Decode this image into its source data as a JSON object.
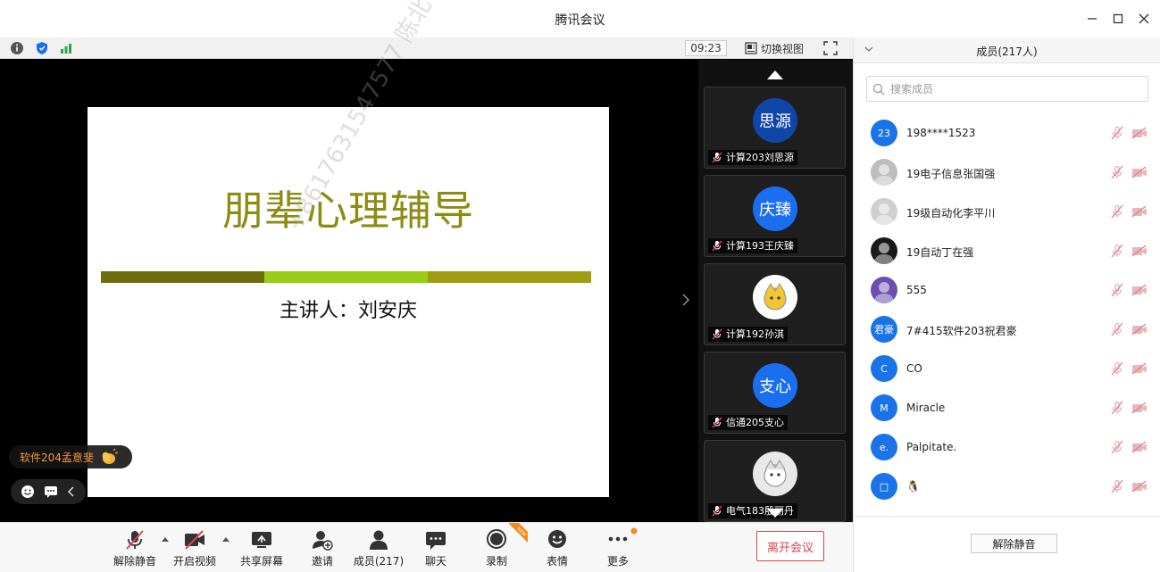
{
  "window": {
    "title": "腾讯会议"
  },
  "infobar": {
    "time": "09:23",
    "switch_view_label": "切换视图"
  },
  "slide": {
    "title": "朋辈心理辅导",
    "subtitle": "主讲人：刘安庆",
    "watermark": "+8617631547577 陈北",
    "bar_colors": [
      "#6e6e0e",
      "#99cc12",
      "#a09e0e"
    ]
  },
  "speaker": {
    "name": "软件204孟意斐"
  },
  "thumbnails": [
    {
      "avatar_text": "思源",
      "name": "计算203刘思源",
      "avatar_color": "#1046a8"
    },
    {
      "avatar_text": "庆臻",
      "name": "计算193王庆臻",
      "avatar_color": "#1a6ef0"
    },
    {
      "avatar_text": "",
      "name": "计算192孙淇",
      "avatar_color": "#ffffff"
    },
    {
      "avatar_text": "支心",
      "name": "信通205支心",
      "avatar_color": "#1a6ef0"
    },
    {
      "avatar_text": "",
      "name": "电气183殷丽丹",
      "avatar_color": "#e8e8e8"
    }
  ],
  "toolbar": {
    "unmute": "解除静音",
    "video": "开启视频",
    "share": "共享屏幕",
    "invite": "邀请",
    "members": "成员(217)",
    "chat": "聊天",
    "record": "录制",
    "emoji": "表情",
    "more": "更多",
    "leave": "离开会议",
    "new_badge": "NEW"
  },
  "panel": {
    "title": "成员(217人)",
    "search_placeholder": "搜索成员",
    "unmute_all": "解除静音",
    "members": [
      {
        "avatar": "23",
        "name": "198****1523",
        "color": "#1a74e8"
      },
      {
        "avatar": "",
        "name": "19电子信息张国强",
        "color": "#bdbdbd"
      },
      {
        "avatar": "",
        "name": "19级自动化李平川",
        "color": "#cfcfcf"
      },
      {
        "avatar": "",
        "name": "19自动丁在强",
        "color": "#1a1a1a"
      },
      {
        "avatar": "",
        "name": "555",
        "color": "#6b4fb0"
      },
      {
        "avatar": "君豪",
        "name": "7#415软件203祝君豪",
        "color": "#1a74e8"
      },
      {
        "avatar": "C",
        "name": "CO",
        "color": "#1a74e8"
      },
      {
        "avatar": "M",
        "name": "Miracle",
        "color": "#1a74e8"
      },
      {
        "avatar": "e.",
        "name": "Palpitate.",
        "color": "#1a74e8"
      },
      {
        "avatar": "□",
        "name": "🐧",
        "color": "#1a74e8"
      }
    ]
  }
}
